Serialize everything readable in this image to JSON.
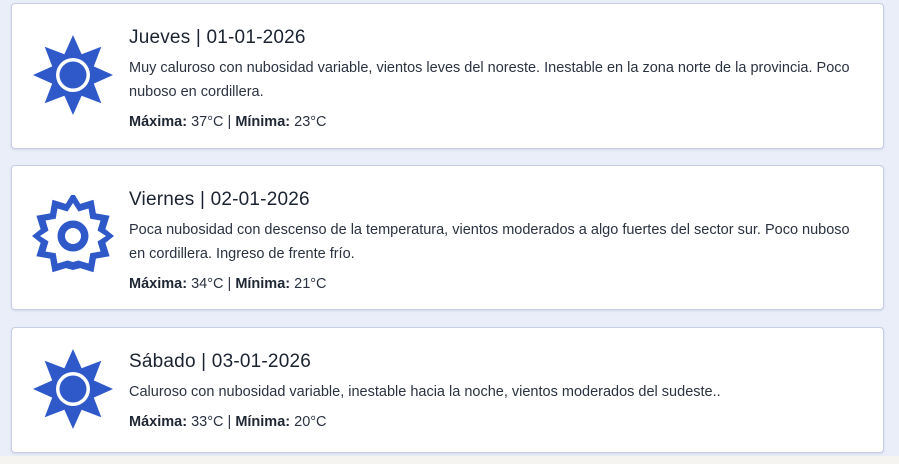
{
  "colors": {
    "icon": "#2f59c9",
    "card_border": "#c5cee3",
    "background": "#e9eef8"
  },
  "forecast": [
    {
      "icon": "sun-icon",
      "title": "Jueves | 01-01-2026",
      "description": "Muy caluroso con nubosidad variable, vientos leves del noreste. Inestable en la zona norte de la provincia. Poco nuboso en cordillera.",
      "max_label": "Máxima:",
      "max_value": "37°C",
      "separator": "|",
      "min_label": "Mínima:",
      "min_value": "23°C"
    },
    {
      "icon": "partly-sunny-icon",
      "title": "Viernes | 02-01-2026",
      "description": "Poca nubosidad con descenso de la temperatura, vientos moderados a algo fuertes del sector sur. Poco nuboso en cordillera. Ingreso de frente frío.",
      "max_label": "Máxima:",
      "max_value": "34°C",
      "separator": "|",
      "min_label": "Mínima:",
      "min_value": "21°C"
    },
    {
      "icon": "sun-icon",
      "title": "Sábado | 03-01-2026",
      "description": "Caluroso con nubosidad variable, inestable hacia la noche, vientos moderados del sudeste..",
      "max_label": "Máxima:",
      "max_value": "33°C",
      "separator": "|",
      "min_label": "Mínima:",
      "min_value": "20°C"
    }
  ]
}
